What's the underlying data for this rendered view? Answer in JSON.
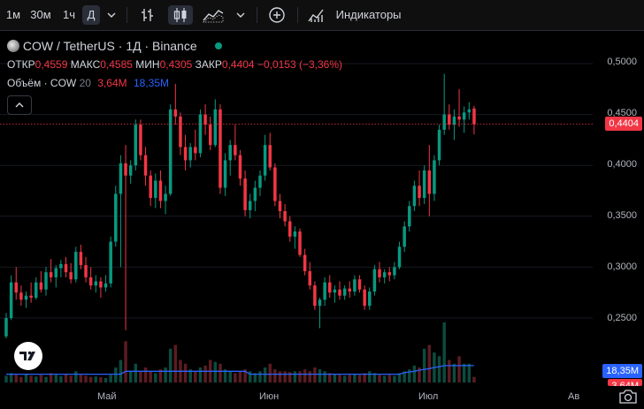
{
  "toolbar": {
    "intervals": [
      "1м",
      "30м",
      "1ч",
      "Д"
    ],
    "active_interval": "Д",
    "indicators_label": "Индикаторы"
  },
  "legend": {
    "symbol": "COW / TetherUS · 1Д · Binance",
    "open_label": "ОТКР",
    "open": "0,4559",
    "high_label": "МАКС",
    "high": "0,4585",
    "low_label": "МИН",
    "low": "0,4305",
    "close_label": "ЗАКР",
    "close": "0,4404",
    "change": "−0,0153 (−3,36%)",
    "volume_label": "Объём · COW",
    "volume_length": "20",
    "volume_value": "3,64M",
    "volume_ma": "18,35M"
  },
  "price_axis": {
    "ticks": [
      "0,5000",
      "0,4500",
      "0,4000",
      "0,3500",
      "0,3000",
      "0,2500"
    ],
    "last_price": "0,4404",
    "volume_ma_tag": "18,35M",
    "volume_tag": "3,64M"
  },
  "time_axis": [
    "Май",
    "Июн",
    "Июл",
    "Ав"
  ],
  "colors": {
    "up": "#089981",
    "down": "#f23645",
    "vol_up": "#0c4a3f",
    "vol_down": "#5b1c22",
    "ma": "#2962ff"
  },
  "chart_data": {
    "type": "candlestick",
    "timeframe": "1D",
    "y_range": [
      0.22,
      0.52
    ],
    "candles": [
      [
        0.232,
        0.255,
        0.23,
        0.25
      ],
      [
        0.25,
        0.292,
        0.248,
        0.285
      ],
      [
        0.285,
        0.3,
        0.268,
        0.275
      ],
      [
        0.275,
        0.282,
        0.262,
        0.268
      ],
      [
        0.268,
        0.276,
        0.26,
        0.272
      ],
      [
        0.272,
        0.285,
        0.265,
        0.27
      ],
      [
        0.27,
        0.29,
        0.268,
        0.285
      ],
      [
        0.285,
        0.296,
        0.275,
        0.278
      ],
      [
        0.278,
        0.3,
        0.272,
        0.295
      ],
      [
        0.295,
        0.308,
        0.285,
        0.29
      ],
      [
        0.29,
        0.302,
        0.28,
        0.299
      ],
      [
        0.299,
        0.307,
        0.29,
        0.303
      ],
      [
        0.303,
        0.31,
        0.29,
        0.295
      ],
      [
        0.295,
        0.304,
        0.284,
        0.288
      ],
      [
        0.288,
        0.32,
        0.285,
        0.315
      ],
      [
        0.315,
        0.322,
        0.298,
        0.302
      ],
      [
        0.302,
        0.31,
        0.285,
        0.29
      ],
      [
        0.29,
        0.3,
        0.278,
        0.282
      ],
      [
        0.282,
        0.292,
        0.275,
        0.286
      ],
      [
        0.286,
        0.29,
        0.27,
        0.28
      ],
      [
        0.28,
        0.292,
        0.276,
        0.284
      ],
      [
        0.284,
        0.33,
        0.28,
        0.325
      ],
      [
        0.325,
        0.38,
        0.32,
        0.372
      ],
      [
        0.372,
        0.41,
        0.3,
        0.402
      ],
      [
        0.402,
        0.42,
        0.238,
        0.39
      ],
      [
        0.39,
        0.405,
        0.382,
        0.4
      ],
      [
        0.4,
        0.445,
        0.395,
        0.44
      ],
      [
        0.44,
        0.445,
        0.405,
        0.41
      ],
      [
        0.41,
        0.418,
        0.38,
        0.39
      ],
      [
        0.39,
        0.395,
        0.36,
        0.368
      ],
      [
        0.368,
        0.392,
        0.358,
        0.385
      ],
      [
        0.385,
        0.395,
        0.358,
        0.365
      ],
      [
        0.365,
        0.38,
        0.352,
        0.372
      ],
      [
        0.372,
        0.46,
        0.37,
        0.455
      ],
      [
        0.455,
        0.48,
        0.44,
        0.448
      ],
      [
        0.448,
        0.452,
        0.41,
        0.418
      ],
      [
        0.418,
        0.43,
        0.395,
        0.405
      ],
      [
        0.405,
        0.422,
        0.398,
        0.418
      ],
      [
        0.418,
        0.435,
        0.405,
        0.412
      ],
      [
        0.412,
        0.455,
        0.408,
        0.45
      ],
      [
        0.45,
        0.46,
        0.43,
        0.44
      ],
      [
        0.44,
        0.448,
        0.415,
        0.42
      ],
      [
        0.42,
        0.465,
        0.418,
        0.455
      ],
      [
        0.455,
        0.46,
        0.372,
        0.378
      ],
      [
        0.378,
        0.412,
        0.37,
        0.405
      ],
      [
        0.405,
        0.425,
        0.39,
        0.42
      ],
      [
        0.42,
        0.44,
        0.405,
        0.41
      ],
      [
        0.41,
        0.415,
        0.38,
        0.387
      ],
      [
        0.387,
        0.395,
        0.35,
        0.356
      ],
      [
        0.356,
        0.372,
        0.348,
        0.365
      ],
      [
        0.365,
        0.385,
        0.355,
        0.378
      ],
      [
        0.378,
        0.395,
        0.37,
        0.39
      ],
      [
        0.39,
        0.43,
        0.385,
        0.42
      ],
      [
        0.42,
        0.432,
        0.395,
        0.398
      ],
      [
        0.398,
        0.402,
        0.36,
        0.365
      ],
      [
        0.365,
        0.372,
        0.348,
        0.355
      ],
      [
        0.355,
        0.362,
        0.34,
        0.345
      ],
      [
        0.345,
        0.35,
        0.325,
        0.33
      ],
      [
        0.33,
        0.34,
        0.318,
        0.335
      ],
      [
        0.335,
        0.338,
        0.31,
        0.312
      ],
      [
        0.312,
        0.318,
        0.292,
        0.296
      ],
      [
        0.296,
        0.305,
        0.278,
        0.282
      ],
      [
        0.282,
        0.286,
        0.258,
        0.262
      ],
      [
        0.262,
        0.27,
        0.24,
        0.268
      ],
      [
        0.268,
        0.29,
        0.262,
        0.285
      ],
      [
        0.285,
        0.292,
        0.27,
        0.275
      ],
      [
        0.275,
        0.282,
        0.265,
        0.278
      ],
      [
        0.278,
        0.286,
        0.268,
        0.272
      ],
      [
        0.272,
        0.282,
        0.268,
        0.279
      ],
      [
        0.279,
        0.286,
        0.27,
        0.276
      ],
      [
        0.276,
        0.292,
        0.272,
        0.288
      ],
      [
        0.288,
        0.292,
        0.275,
        0.278
      ],
      [
        0.278,
        0.282,
        0.258,
        0.262
      ],
      [
        0.262,
        0.28,
        0.258,
        0.276
      ],
      [
        0.276,
        0.302,
        0.272,
        0.298
      ],
      [
        0.298,
        0.305,
        0.285,
        0.29
      ],
      [
        0.29,
        0.298,
        0.284,
        0.295
      ],
      [
        0.295,
        0.3,
        0.286,
        0.292
      ],
      [
        0.292,
        0.305,
        0.288,
        0.3
      ],
      [
        0.3,
        0.325,
        0.298,
        0.32
      ],
      [
        0.32,
        0.345,
        0.315,
        0.34
      ],
      [
        0.34,
        0.365,
        0.335,
        0.36
      ],
      [
        0.36,
        0.385,
        0.355,
        0.38
      ],
      [
        0.38,
        0.395,
        0.36,
        0.368
      ],
      [
        0.368,
        0.4,
        0.362,
        0.395
      ],
      [
        0.395,
        0.42,
        0.35,
        0.372
      ],
      [
        0.372,
        0.41,
        0.365,
        0.405
      ],
      [
        0.405,
        0.44,
        0.4,
        0.435
      ],
      [
        0.435,
        0.49,
        0.43,
        0.45
      ],
      [
        0.45,
        0.46,
        0.435,
        0.44
      ],
      [
        0.44,
        0.455,
        0.425,
        0.448
      ],
      [
        0.448,
        0.475,
        0.438,
        0.445
      ],
      [
        0.445,
        0.458,
        0.432,
        0.452
      ],
      [
        0.452,
        0.462,
        0.445,
        0.455
      ],
      [
        0.4559,
        0.4585,
        0.4305,
        0.4404
      ]
    ],
    "volume_ma": [
      0.22,
      0.22,
      0.22,
      0.22,
      0.22,
      0.22,
      0.22,
      0.22,
      0.22,
      0.22,
      0.22,
      0.22,
      0.22,
      0.22,
      0.22,
      0.22,
      0.22,
      0.22,
      0.22,
      0.22,
      0.22,
      0.22,
      0.22,
      0.22,
      0.3,
      0.3,
      0.3,
      0.3,
      0.3,
      0.3,
      0.3,
      0.3,
      0.3,
      0.3,
      0.3,
      0.3,
      0.3,
      0.3,
      0.3,
      0.3,
      0.3,
      0.3,
      0.3,
      0.3,
      0.3,
      0.3,
      0.3,
      0.3,
      0.3,
      0.22,
      0.22,
      0.22,
      0.22,
      0.22,
      0.22,
      0.22,
      0.22,
      0.22,
      0.22,
      0.22,
      0.22,
      0.22,
      0.22,
      0.22,
      0.22,
      0.22,
      0.22,
      0.22,
      0.22,
      0.22,
      0.22,
      0.22,
      0.22,
      0.22,
      0.22,
      0.22,
      0.22,
      0.22,
      0.22,
      0.22,
      0.26,
      0.28,
      0.3,
      0.33,
      0.35,
      0.37,
      0.4,
      0.42,
      0.45,
      0.45,
      0.45,
      0.45,
      0.45,
      0.45,
      0.45
    ],
    "volumes": [
      0.18,
      0.25,
      0.2,
      0.15,
      0.22,
      0.18,
      0.16,
      0.2,
      0.15,
      0.25,
      0.2,
      0.17,
      0.22,
      0.18,
      0.3,
      0.2,
      0.18,
      0.15,
      0.16,
      0.14,
      0.12,
      0.2,
      0.4,
      0.6,
      1.1,
      0.3,
      0.5,
      0.3,
      0.4,
      0.3,
      0.25,
      0.35,
      0.4,
      0.9,
      1.0,
      0.6,
      0.5,
      0.35,
      0.3,
      0.4,
      0.45,
      0.6,
      0.55,
      0.5,
      0.35,
      0.3,
      0.25,
      0.3,
      0.35,
      0.3,
      0.25,
      0.3,
      0.4,
      0.5,
      0.35,
      0.3,
      0.3,
      0.28,
      0.3,
      0.3,
      0.35,
      0.3,
      0.4,
      0.35,
      0.3,
      0.25,
      0.22,
      0.2,
      0.18,
      0.2,
      0.22,
      0.2,
      0.25,
      0.3,
      0.25,
      0.2,
      0.18,
      0.2,
      0.18,
      0.25,
      0.3,
      0.35,
      0.45,
      0.4,
      0.9,
      1.0,
      0.8,
      0.7,
      1.6,
      0.6,
      0.5,
      0.7,
      0.5,
      0.5,
      0.15
    ]
  }
}
